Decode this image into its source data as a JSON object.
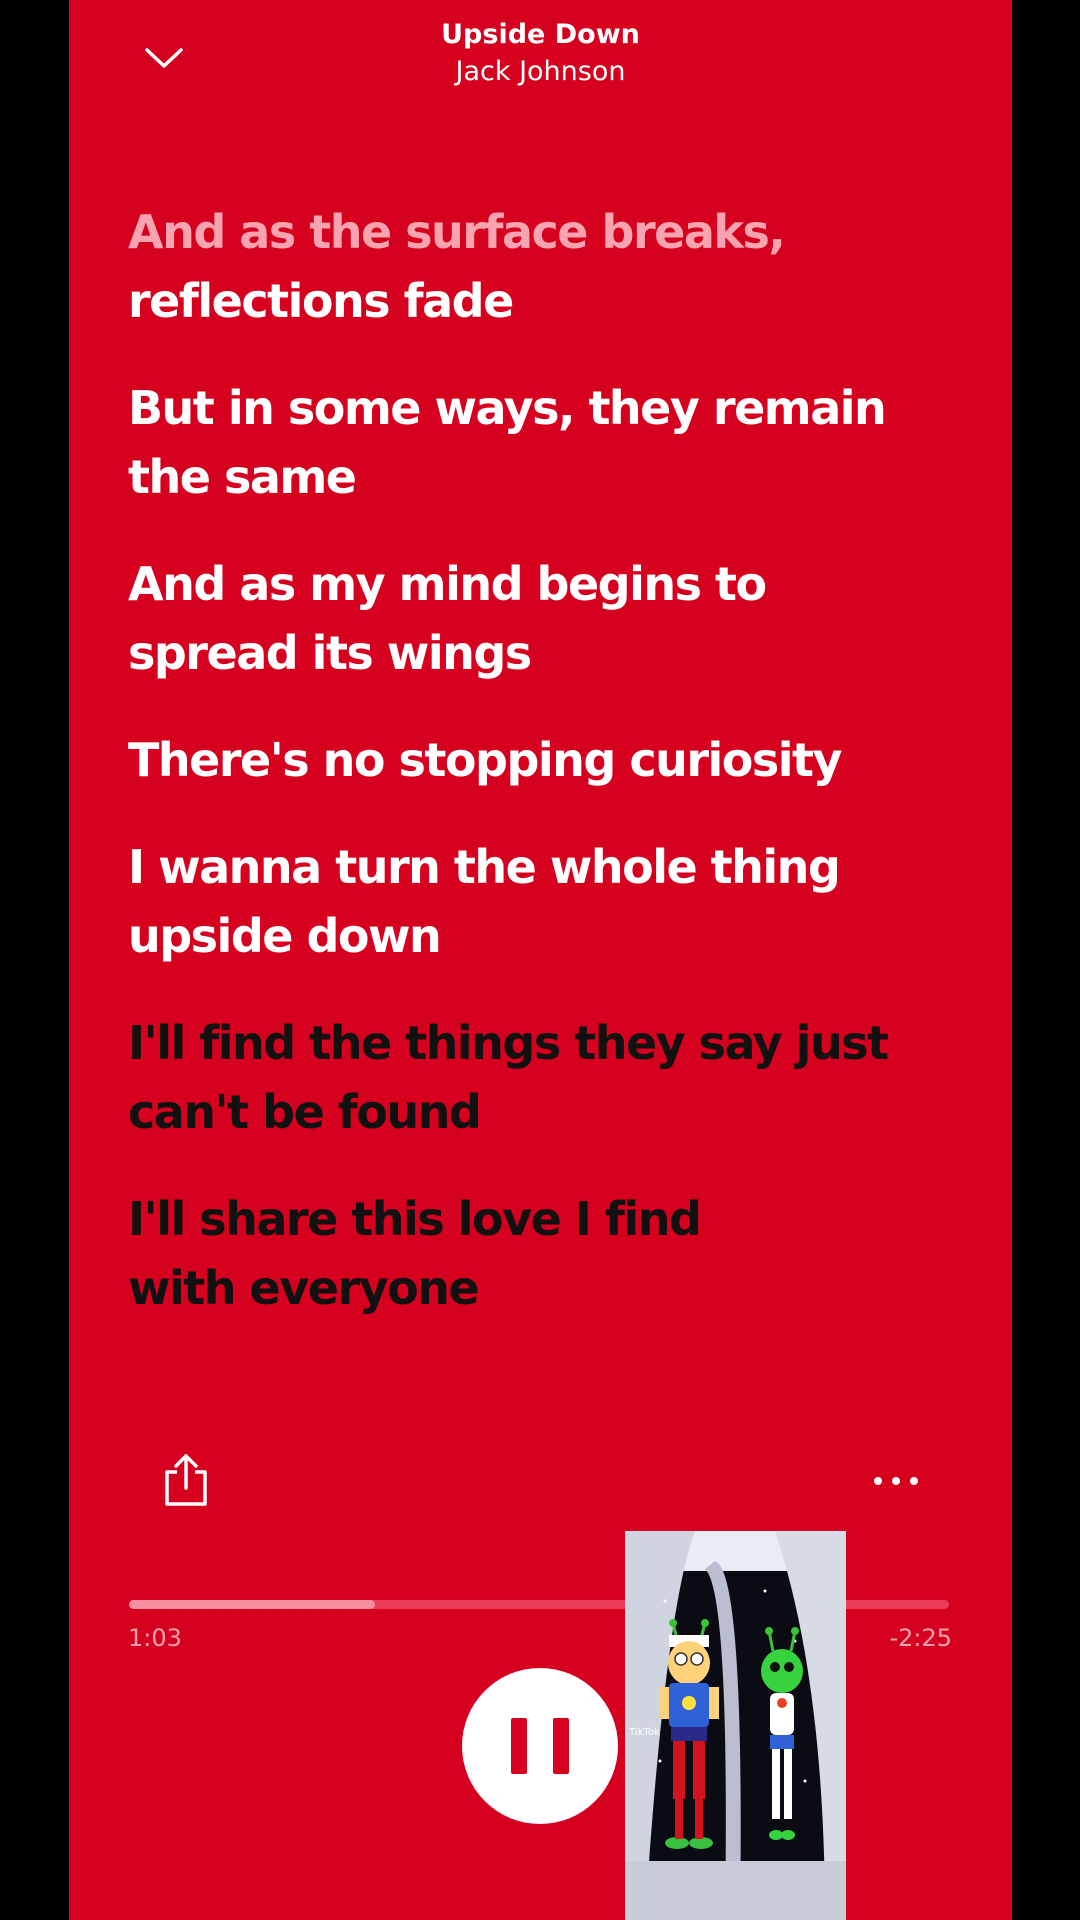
{
  "header": {
    "title": "Upside Down",
    "artist": "Jack Johnson"
  },
  "lyrics": [
    {
      "state": "past",
      "segments": [
        "And as the surface breaks,",
        "reflections fade"
      ]
    },
    {
      "state": "current",
      "segments": [
        "But in some ways, they remain",
        "the same"
      ]
    },
    {
      "state": "current",
      "segments": [
        "And as my mind begins to",
        "spread its wings"
      ]
    },
    {
      "state": "current",
      "segments": [
        "There's no stopping curiosity"
      ]
    },
    {
      "state": "current",
      "segments": [
        "I wanna turn the whole thing",
        "upside down"
      ]
    },
    {
      "state": "upcoming",
      "segments": [
        "I'll find the things they say just",
        "can't be found"
      ]
    },
    {
      "state": "upcoming",
      "segments": [
        "I'll share this love I find",
        "with everyone"
      ]
    }
  ],
  "playback": {
    "elapsed": "1:03",
    "remaining": "-2:25",
    "progress_percent": 30,
    "state": "playing"
  },
  "pip_video": {
    "watermark": "TikTok"
  },
  "colors": {
    "background": "#d6001f",
    "lyric_active": "#ffffff",
    "lyric_faded": "#f7a3b0",
    "lyric_upcoming": "#111111"
  },
  "icons": {
    "collapse": "chevron-down-icon",
    "share": "share-icon",
    "more": "more-horizontal-icon",
    "pause": "pause-icon"
  }
}
